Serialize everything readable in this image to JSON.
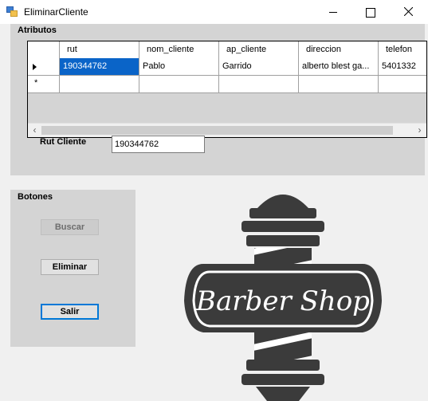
{
  "window": {
    "title": "EliminarCliente"
  },
  "attributes_group": {
    "title": "Atributos",
    "grid": {
      "columns": [
        "rut",
        "nom_cliente",
        "ap_cliente",
        "direccion",
        "telefon"
      ],
      "rows": [
        {
          "rut": "190344762",
          "nom_cliente": "Pablo",
          "ap_cliente": "Garrido",
          "direccion": "alberto blest ga...",
          "telefono": "5401332"
        }
      ],
      "new_row_marker": "*"
    }
  },
  "rut_field": {
    "label": "Rut Cliente",
    "value": "190344762"
  },
  "buttons_group": {
    "title": "Botones",
    "buscar": "Buscar",
    "eliminar": "Eliminar",
    "salir": "Salir"
  },
  "logo": {
    "text": "Barber Shop",
    "colors": {
      "dark": "#3b3b3b",
      "light": "#ffffff"
    }
  },
  "colors": {
    "selection": "#0a64c8",
    "focus_border": "#0078d7",
    "group_bg": "#d4d4d4"
  }
}
